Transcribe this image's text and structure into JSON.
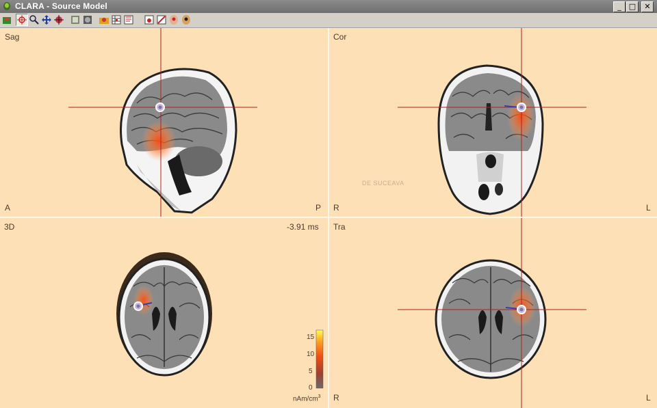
{
  "window": {
    "title": "CLARA - Source Model",
    "minimize": "_",
    "maximize": "□",
    "close": "✕"
  },
  "toolbar": {
    "buttons": [
      "open-icon",
      "cursor-icon",
      "zoom-icon",
      "pan-icon",
      "center-icon",
      "slice-icon",
      "volume-icon",
      "load-source-icon",
      "source-table-icon",
      "export-icon",
      "marker-icon",
      "measure-icon",
      "head-icon",
      "settings-icon"
    ]
  },
  "panels": {
    "sagittal": {
      "name": "Sag",
      "left": "A",
      "right": "P"
    },
    "coronal": {
      "name": "Cor",
      "left": "R",
      "right": "L"
    },
    "three_d": {
      "name": "3D",
      "time": "-3.91 ms"
    },
    "transverse": {
      "name": "Tra",
      "left": "R",
      "right": "L"
    }
  },
  "colorbar": {
    "ticks": [
      "15",
      "10",
      "5",
      "0"
    ],
    "unit": "nAm/cm",
    "unit_sup": "3"
  },
  "watermark": "DE SUCEAVA",
  "colors": {
    "panel_bg": "#fde0b6",
    "crosshair": "#b02020",
    "source_hot": "#ff5a14"
  }
}
